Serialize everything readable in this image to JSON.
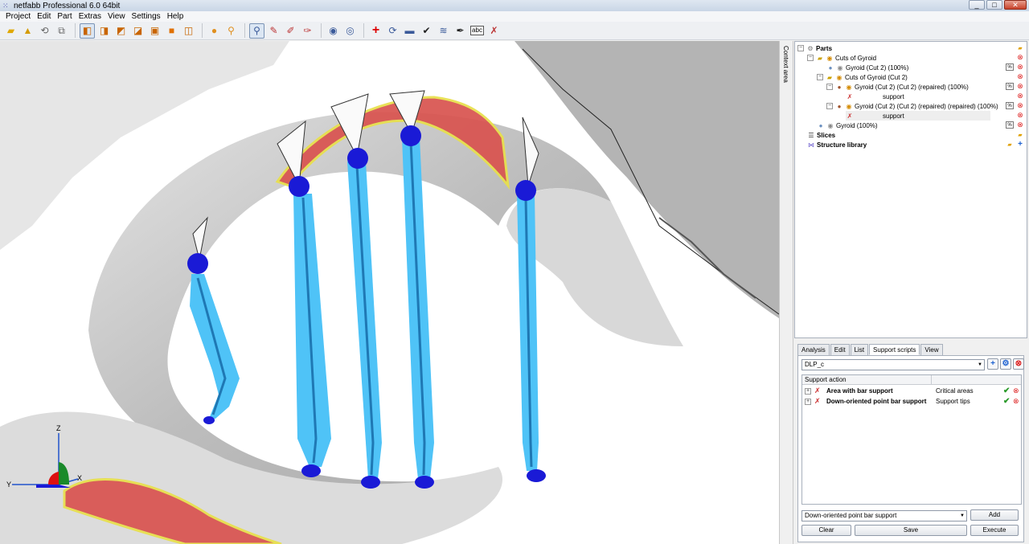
{
  "window": {
    "title": "netfabb Professional 6.0 64bit",
    "controls": [
      "_",
      "□",
      "✕"
    ]
  },
  "menu": [
    "Project",
    "Edit",
    "Part",
    "Extras",
    "View",
    "Settings",
    "Help"
  ],
  "toolbar": {
    "icons": [
      "open-icon",
      "add-part-icon",
      "reset-view-icon",
      "copy-view-icon",
      "view-front-icon",
      "view-back-icon",
      "view-left-icon",
      "view-right-icon",
      "view-top-icon",
      "view-bottom-icon",
      "shade-icon",
      "zoom-icon",
      "select-icon",
      "cut-icon",
      "measure-icon",
      "section-icon",
      "add-part-sphere-icon",
      "remove-part-sphere-icon",
      "repair-icon",
      "rotate-icon",
      "ruler-icon",
      "check-icon",
      "mesh-icon",
      "pen-icon",
      "text-label-icon",
      "support-tool-icon"
    ],
    "text_label": "abc"
  },
  "viewport": {
    "axis": {
      "z": "Z",
      "y": "Y",
      "x": "X"
    }
  },
  "context_tab": "Context area",
  "tree": {
    "rows": [
      {
        "label": "Parts",
        "bold": true
      },
      {
        "label": "Cuts of Gyroid",
        "bold": false
      },
      {
        "label": "Gyroid (Cut 2) (100%)",
        "bold": false
      },
      {
        "label": "Cuts of Gyroid (Cut 2)",
        "bold": false
      },
      {
        "label": "Gyroid (Cut 2) (Cut 2) (repaired) (100%)",
        "bold": false
      },
      {
        "label": "support",
        "bold": false
      },
      {
        "label": "Gyroid (Cut 2) (Cut 2) (repaired) (repaired) (100%)",
        "bold": false
      },
      {
        "label": "support",
        "bold": false
      },
      {
        "label": "Gyroid (100%)",
        "bold": false
      },
      {
        "label": "Slices",
        "bold": true
      },
      {
        "label": "Structure library",
        "bold": true
      }
    ]
  },
  "panel": {
    "tabs": [
      "Analysis",
      "Edit",
      "List",
      "Support scripts",
      "View"
    ],
    "active_tab": "Support scripts",
    "script_name": "DLP_c",
    "table_headers": [
      "Support action",
      ""
    ],
    "actions": [
      {
        "name": "Area with bar support",
        "type": "Critical areas"
      },
      {
        "name": "Down-oriented point bar support",
        "type": "Support tips"
      }
    ],
    "action_select": "Down-oriented point bar support",
    "buttons": {
      "add": "Add",
      "clear": "Clear",
      "save": "Save",
      "execute": "Execute"
    }
  },
  "colors": {
    "support_bar": "#4fc3f7",
    "support_bar_core": "#1f78b4",
    "support_node": "#1a1ad6",
    "critical_area": "#d9534f",
    "critical_edge": "#e8e04a",
    "part_surface": "#d0d0d0"
  }
}
